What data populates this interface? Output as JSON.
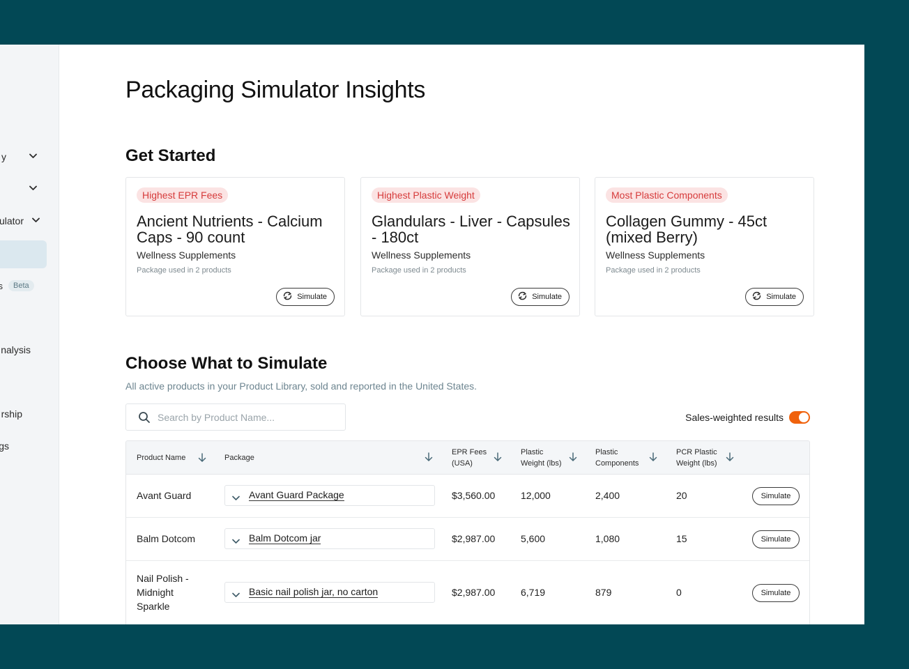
{
  "sidebar": {
    "items": [
      {
        "label": "y",
        "has_chevron": true
      },
      {
        "label": "",
        "has_chevron": true
      },
      {
        "label": "ulator",
        "has_chevron": true
      },
      {
        "label": "s",
        "badge": "Beta"
      },
      {
        "label": "nalysis"
      },
      {
        "label": "rship"
      },
      {
        "label": "gs"
      }
    ]
  },
  "page": {
    "title": "Packaging Simulator Insights"
  },
  "get_started": {
    "title": "Get Started",
    "cards": [
      {
        "tag": "Highest EPR Fees",
        "product": "Ancient Nutrients - Calcium Caps - 90 count",
        "category": "Wellness Supplements",
        "usage": "Package used in 2 products",
        "button": "Simulate"
      },
      {
        "tag": "Highest Plastic Weight",
        "product": "Glandulars - Liver - Capsules - 180ct",
        "category": "Wellness Supplements",
        "usage": "Package used in 2 products",
        "button": "Simulate"
      },
      {
        "tag": "Most Plastic Components",
        "product": "Collagen Gummy - 45ct (mixed Berry)",
        "category": "Wellness Supplements",
        "usage": "Package used in 2 products",
        "button": "Simulate"
      }
    ]
  },
  "choose": {
    "title": "Choose What to Simulate",
    "subtitle": "All active products in your Product Library, sold and reported in the United States.",
    "search_placeholder": "Search by Product Name...",
    "toggle_label": "Sales-weighted results",
    "toggle_on": true
  },
  "table": {
    "columns": [
      {
        "line1": "Product Name",
        "line2": ""
      },
      {
        "line1": "Package",
        "line2": ""
      },
      {
        "line1": "EPR Fees",
        "line2": "(USA)"
      },
      {
        "line1": "Plastic",
        "line2": "Weight (lbs)"
      },
      {
        "line1": "Plastic",
        "line2": "Components"
      },
      {
        "line1": "PCR Plastic",
        "line2": "Weight (lbs)"
      }
    ],
    "rows": [
      {
        "product": "Avant Guard",
        "package": "Avant Guard Package",
        "epr_fees": "$3,560.00",
        "plastic_weight": "12,000",
        "plastic_components": "2,400",
        "pcr_weight": "20",
        "button": "Simulate"
      },
      {
        "product": "Balm Dotcom",
        "package": "Balm Dotcom jar",
        "epr_fees": "$2,987.00",
        "plastic_weight": "5,600",
        "plastic_components": "1,080",
        "pcr_weight": "15",
        "button": "Simulate"
      },
      {
        "product": "Nail Polish - Midnight Sparkle",
        "package": "Basic nail polish jar, no carton",
        "epr_fees": "$2,987.00",
        "plastic_weight": "6,719",
        "plastic_components": "879",
        "pcr_weight": "0",
        "button": "Simulate"
      }
    ]
  },
  "colors": {
    "frame_bg": "#024855",
    "accent_orange": "#f0620d",
    "tag_red": "#d63b3b",
    "tag_bg": "#fbe3e3"
  }
}
